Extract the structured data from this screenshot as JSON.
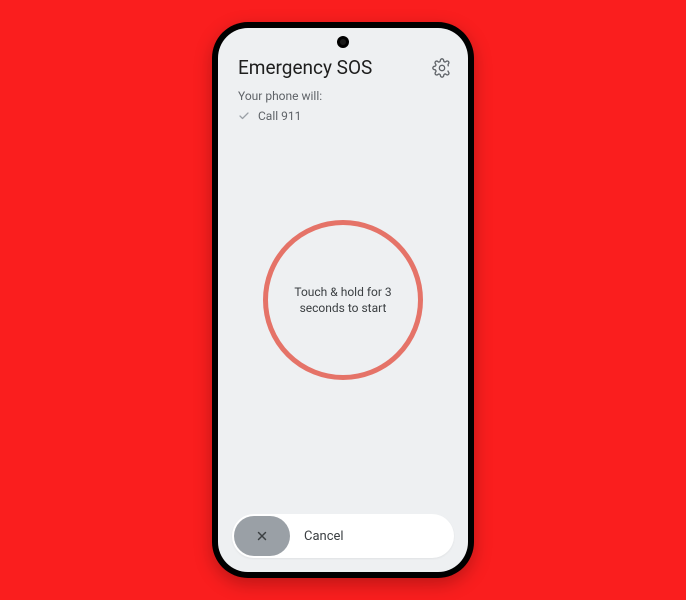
{
  "header": {
    "title": "Emergency SOS"
  },
  "subtitle": "Your phone will:",
  "actions": {
    "item0": "Call 911"
  },
  "hold_button": {
    "label": "Touch & hold for 3 seconds to start"
  },
  "cancel": {
    "label": "Cancel"
  },
  "colors": {
    "background": "#fa1e1e",
    "circle_border": "#e57368"
  }
}
